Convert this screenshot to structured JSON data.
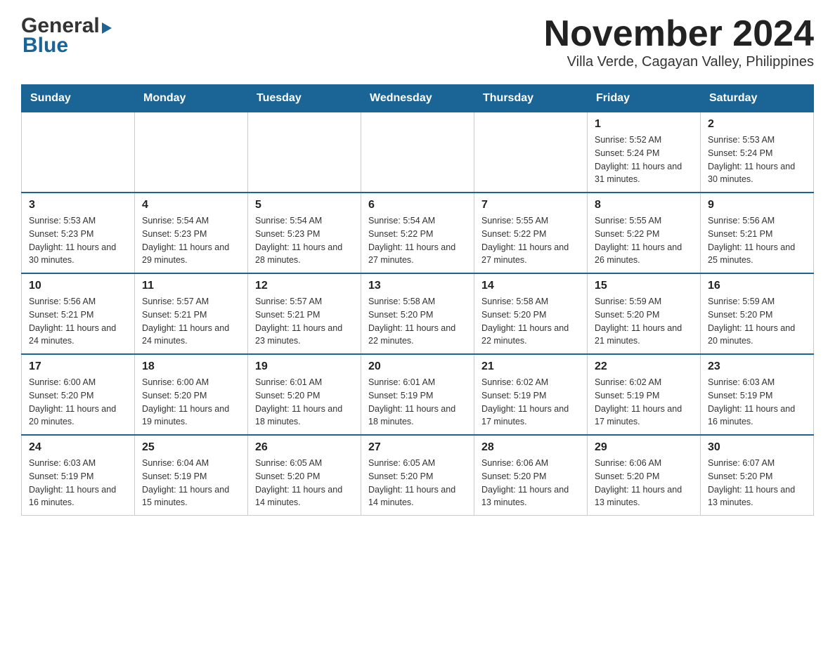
{
  "header": {
    "logo_general": "General",
    "logo_blue": "Blue",
    "month_title": "November 2024",
    "location": "Villa Verde, Cagayan Valley, Philippines"
  },
  "days_of_week": [
    "Sunday",
    "Monday",
    "Tuesday",
    "Wednesday",
    "Thursday",
    "Friday",
    "Saturday"
  ],
  "weeks": [
    {
      "days": [
        {
          "num": "",
          "info": ""
        },
        {
          "num": "",
          "info": ""
        },
        {
          "num": "",
          "info": ""
        },
        {
          "num": "",
          "info": ""
        },
        {
          "num": "",
          "info": ""
        },
        {
          "num": "1",
          "info": "Sunrise: 5:52 AM\nSunset: 5:24 PM\nDaylight: 11 hours\nand 31 minutes."
        },
        {
          "num": "2",
          "info": "Sunrise: 5:53 AM\nSunset: 5:24 PM\nDaylight: 11 hours\nand 30 minutes."
        }
      ]
    },
    {
      "days": [
        {
          "num": "3",
          "info": "Sunrise: 5:53 AM\nSunset: 5:23 PM\nDaylight: 11 hours\nand 30 minutes."
        },
        {
          "num": "4",
          "info": "Sunrise: 5:54 AM\nSunset: 5:23 PM\nDaylight: 11 hours\nand 29 minutes."
        },
        {
          "num": "5",
          "info": "Sunrise: 5:54 AM\nSunset: 5:23 PM\nDaylight: 11 hours\nand 28 minutes."
        },
        {
          "num": "6",
          "info": "Sunrise: 5:54 AM\nSunset: 5:22 PM\nDaylight: 11 hours\nand 27 minutes."
        },
        {
          "num": "7",
          "info": "Sunrise: 5:55 AM\nSunset: 5:22 PM\nDaylight: 11 hours\nand 27 minutes."
        },
        {
          "num": "8",
          "info": "Sunrise: 5:55 AM\nSunset: 5:22 PM\nDaylight: 11 hours\nand 26 minutes."
        },
        {
          "num": "9",
          "info": "Sunrise: 5:56 AM\nSunset: 5:21 PM\nDaylight: 11 hours\nand 25 minutes."
        }
      ]
    },
    {
      "days": [
        {
          "num": "10",
          "info": "Sunrise: 5:56 AM\nSunset: 5:21 PM\nDaylight: 11 hours\nand 24 minutes."
        },
        {
          "num": "11",
          "info": "Sunrise: 5:57 AM\nSunset: 5:21 PM\nDaylight: 11 hours\nand 24 minutes."
        },
        {
          "num": "12",
          "info": "Sunrise: 5:57 AM\nSunset: 5:21 PM\nDaylight: 11 hours\nand 23 minutes."
        },
        {
          "num": "13",
          "info": "Sunrise: 5:58 AM\nSunset: 5:20 PM\nDaylight: 11 hours\nand 22 minutes."
        },
        {
          "num": "14",
          "info": "Sunrise: 5:58 AM\nSunset: 5:20 PM\nDaylight: 11 hours\nand 22 minutes."
        },
        {
          "num": "15",
          "info": "Sunrise: 5:59 AM\nSunset: 5:20 PM\nDaylight: 11 hours\nand 21 minutes."
        },
        {
          "num": "16",
          "info": "Sunrise: 5:59 AM\nSunset: 5:20 PM\nDaylight: 11 hours\nand 20 minutes."
        }
      ]
    },
    {
      "days": [
        {
          "num": "17",
          "info": "Sunrise: 6:00 AM\nSunset: 5:20 PM\nDaylight: 11 hours\nand 20 minutes."
        },
        {
          "num": "18",
          "info": "Sunrise: 6:00 AM\nSunset: 5:20 PM\nDaylight: 11 hours\nand 19 minutes."
        },
        {
          "num": "19",
          "info": "Sunrise: 6:01 AM\nSunset: 5:20 PM\nDaylight: 11 hours\nand 18 minutes."
        },
        {
          "num": "20",
          "info": "Sunrise: 6:01 AM\nSunset: 5:19 PM\nDaylight: 11 hours\nand 18 minutes."
        },
        {
          "num": "21",
          "info": "Sunrise: 6:02 AM\nSunset: 5:19 PM\nDaylight: 11 hours\nand 17 minutes."
        },
        {
          "num": "22",
          "info": "Sunrise: 6:02 AM\nSunset: 5:19 PM\nDaylight: 11 hours\nand 17 minutes."
        },
        {
          "num": "23",
          "info": "Sunrise: 6:03 AM\nSunset: 5:19 PM\nDaylight: 11 hours\nand 16 minutes."
        }
      ]
    },
    {
      "days": [
        {
          "num": "24",
          "info": "Sunrise: 6:03 AM\nSunset: 5:19 PM\nDaylight: 11 hours\nand 16 minutes."
        },
        {
          "num": "25",
          "info": "Sunrise: 6:04 AM\nSunset: 5:19 PM\nDaylight: 11 hours\nand 15 minutes."
        },
        {
          "num": "26",
          "info": "Sunrise: 6:05 AM\nSunset: 5:20 PM\nDaylight: 11 hours\nand 14 minutes."
        },
        {
          "num": "27",
          "info": "Sunrise: 6:05 AM\nSunset: 5:20 PM\nDaylight: 11 hours\nand 14 minutes."
        },
        {
          "num": "28",
          "info": "Sunrise: 6:06 AM\nSunset: 5:20 PM\nDaylight: 11 hours\nand 13 minutes."
        },
        {
          "num": "29",
          "info": "Sunrise: 6:06 AM\nSunset: 5:20 PM\nDaylight: 11 hours\nand 13 minutes."
        },
        {
          "num": "30",
          "info": "Sunrise: 6:07 AM\nSunset: 5:20 PM\nDaylight: 11 hours\nand 13 minutes."
        }
      ]
    }
  ]
}
